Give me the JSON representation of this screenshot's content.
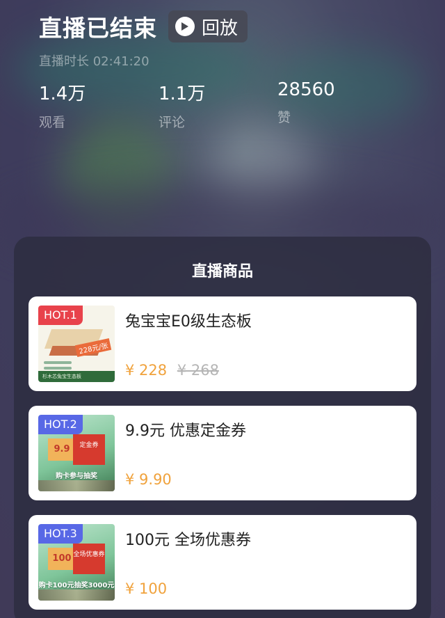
{
  "header": {
    "title": "直播已结束",
    "replay_label": "回放",
    "duration": "直播时长 02:41:20"
  },
  "stats": [
    {
      "value": "1.4万",
      "label": "观看"
    },
    {
      "value": "1.1万",
      "label": "评论"
    },
    {
      "value": "28560",
      "label": "赞"
    }
  ],
  "panel": {
    "title": "直播商品",
    "products": [
      {
        "badge": "HOT.1",
        "name": "兔宝宝E0级生态板",
        "price": "¥ 228",
        "original_price": "¥ 268",
        "thumb_tag": "228元/张",
        "thumb_caption": "杉木芯兔宝生态板"
      },
      {
        "badge": "HOT.2",
        "name": "9.9元 优惠定金券",
        "price": "¥ 9.90",
        "thumb_coupon_a": "9.9",
        "thumb_coupon_b": "定金券",
        "thumb_caption": "购卡参与抽奖"
      },
      {
        "badge": "HOT.3",
        "name": "100元 全场优惠券",
        "price": "¥ 100",
        "thumb_coupon_a": "100",
        "thumb_coupon_b": "全场优惠券",
        "thumb_caption": "购卡100元抽奖3000元"
      }
    ]
  },
  "colors": {
    "badge_red": "#e8424b",
    "badge_blue": "#5868e6",
    "price": "#f0a23c"
  }
}
